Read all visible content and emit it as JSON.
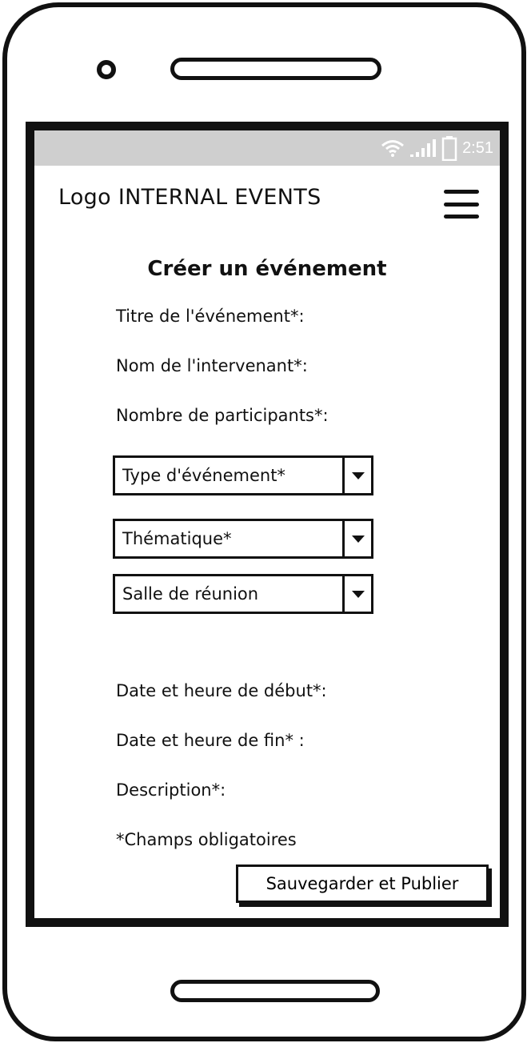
{
  "status_bar": {
    "time": "2:51",
    "icons": [
      "wifi-icon",
      "signal-icon",
      "battery-icon"
    ],
    "background": "#cfcfcf"
  },
  "app_bar": {
    "logo_text": "Logo INTERNAL EVENTS",
    "menu_icon": "hamburger-menu-icon"
  },
  "form": {
    "title": "Créer un événement",
    "fields": {
      "titre_label": "Titre de l'événement*:",
      "intervenant_label": "Nom de l'intervenant*:",
      "participants_label": "Nombre de participants*:",
      "debut_label": "Date et heure de début*:",
      "fin_label": "Date et heure de fin* :",
      "description_label": "Description*:"
    },
    "selects": {
      "type": "Type d'événement*",
      "thematique": "Thématique*",
      "salle": "Salle de réunion"
    },
    "required_note": "*Champs obligatoires",
    "submit_label": "Sauvegarder et Publier"
  }
}
